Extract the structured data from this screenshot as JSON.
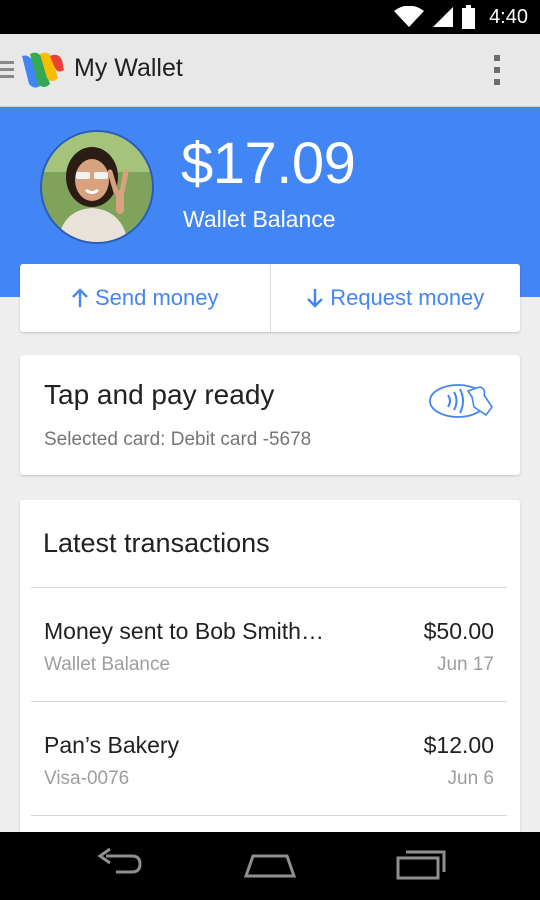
{
  "status_bar": {
    "time": "4:40"
  },
  "app_bar": {
    "title": "My Wallet"
  },
  "header": {
    "balance": "$17.09",
    "balance_label": "Wallet Balance",
    "color": "#4285f4"
  },
  "actions": {
    "send": {
      "label": "Send money",
      "icon": "arrow-up-icon"
    },
    "request": {
      "label": "Request money",
      "icon": "arrow-down-icon"
    }
  },
  "pay_card": {
    "title": "Tap and pay ready",
    "subtitle": "Selected card: Debit card -5678",
    "icon": "tap-and-pay-icon"
  },
  "transactions": {
    "title": "Latest transactions",
    "items": [
      {
        "name": "Money sent to Bob Smith…",
        "source": "Wallet Balance",
        "amount": "$50.00",
        "date": "Jun 17"
      },
      {
        "name": "Pan’s Bakery",
        "source": "Visa-0076",
        "amount": "$12.00",
        "date": "Jun 6"
      }
    ]
  },
  "nav_bar": {
    "icons": [
      "back-icon",
      "home-icon",
      "recents-icon"
    ]
  }
}
